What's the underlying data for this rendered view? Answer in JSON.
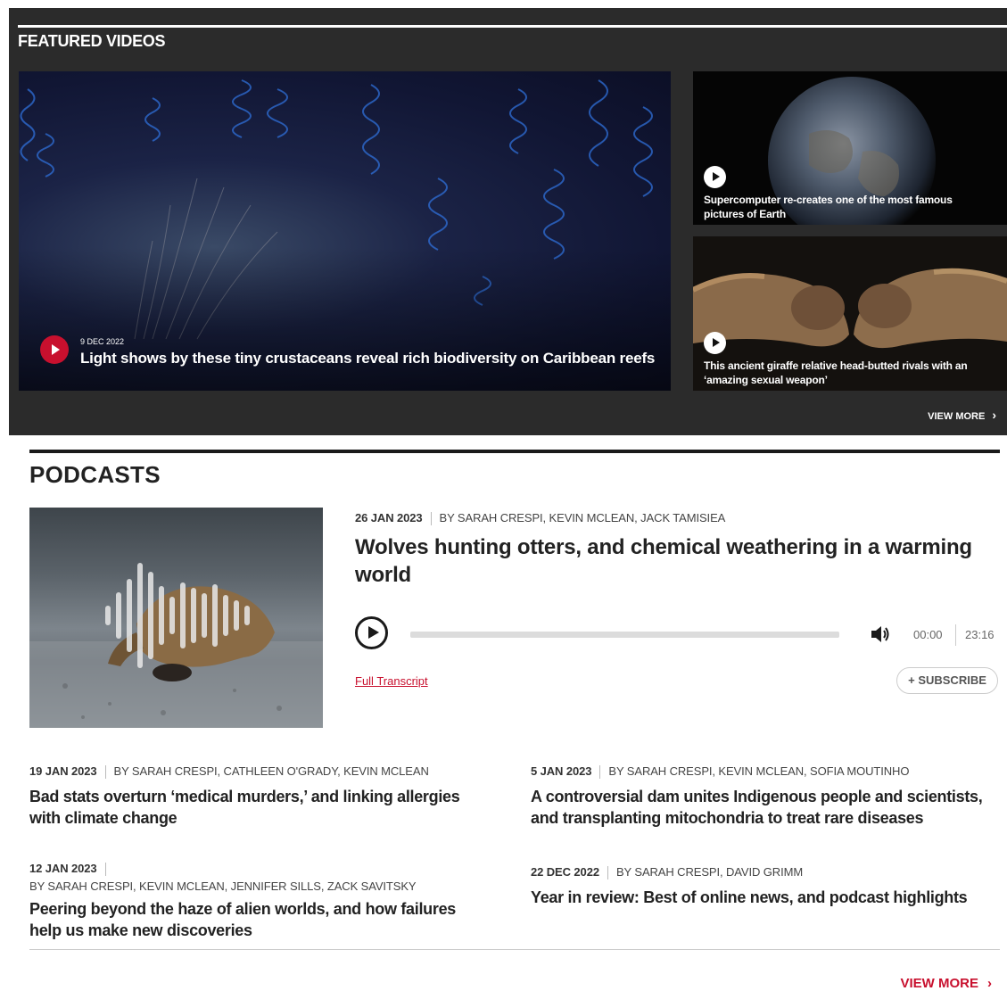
{
  "featured": {
    "heading": "FEATURED VIDEOS",
    "hero": {
      "date": "9 DEC 2022",
      "title": "Light shows by these tiny crustaceans reveal rich biodiversity on Caribbean reefs"
    },
    "side_videos": [
      {
        "title": "Supercomputer re-creates one of the most famous pictures of Earth"
      },
      {
        "title": "This ancient giraffe relative head-butted rivals with an ‘amazing sexual weapon’"
      }
    ],
    "view_more": "VIEW MORE",
    "chevron": "›"
  },
  "podcasts": {
    "heading": "PODCASTS",
    "latest": {
      "date": "26 JAN 2023",
      "byline": "BY SARAH CRESPI, KEVIN MCLEAN, JACK TAMISIEA",
      "title": "Wolves hunting otters, and chemical weathering in a warming world",
      "time_current": "00:00",
      "time_total": "23:16",
      "transcript_label": "Full Transcript",
      "subscribe_label": "+ SUBSCRIBE"
    },
    "episodes": [
      {
        "date": "19 JAN 2023",
        "byline": "BY SARAH CRESPI, CATHLEEN O'GRADY, KEVIN MCLEAN",
        "title": "Bad stats overturn ‘medical murders,’ and linking allergies with climate change"
      },
      {
        "date": "5 JAN 2023",
        "byline": "BY SARAH CRESPI, KEVIN MCLEAN, SOFIA MOUTINHO",
        "title": "A controversial dam unites Indigenous people and scientists, and transplanting mitochondria to treat rare diseases"
      },
      {
        "date": "12 JAN 2023",
        "byline": "BY SARAH CRESPI, KEVIN MCLEAN, JENNIFER SILLS, ZACK SAVITSKY",
        "title": "Peering beyond the haze of alien worlds, and how failures help us make new discoveries"
      },
      {
        "date": "22 DEC 2022",
        "byline": "BY SARAH CRESPI, DAVID GRIMM",
        "title": "Year in review: Best of online news, and podcast highlights"
      }
    ],
    "view_more": "VIEW MORE",
    "chevron": "›"
  },
  "colors": {
    "accent": "#c8102e",
    "panel": "#2b2b2b"
  },
  "icons": [
    "play-icon",
    "volume-icon",
    "chevron-right-icon"
  ]
}
